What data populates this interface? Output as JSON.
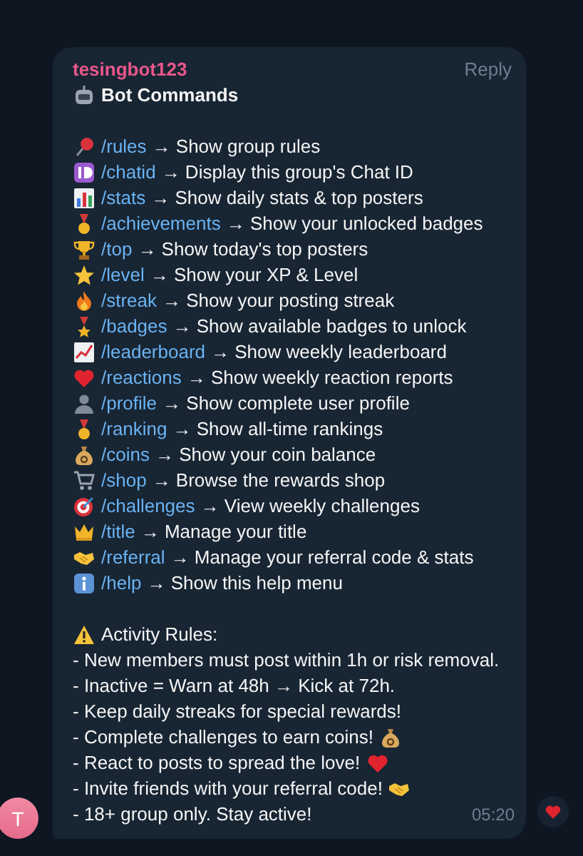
{
  "message": {
    "sender": "tesingbot123",
    "reply_label": "Reply",
    "title": "Bot Commands",
    "commands": [
      {
        "command": "/rules",
        "description": "→ Show group rules"
      },
      {
        "command": "/chatid",
        "description": "→ Display this group's Chat ID"
      },
      {
        "command": "/stats",
        "description": "→ Show daily stats & top posters"
      },
      {
        "command": "/achievements",
        "description": "→ Show your unlocked badges"
      },
      {
        "command": "/top",
        "description": "→ Show today's top posters"
      },
      {
        "command": "/level",
        "description": "→ Show your XP & Level"
      },
      {
        "command": "/streak",
        "description": "→ Show your posting streak"
      },
      {
        "command": "/badges",
        "description": "→ Show available badges to unlock"
      },
      {
        "command": "/leaderboard",
        "description": "→ Show weekly leaderboard"
      },
      {
        "command": "/reactions",
        "description": "→ Show weekly reaction reports"
      },
      {
        "command": "/profile",
        "description": "→ Show complete user profile"
      },
      {
        "command": "/ranking",
        "description": "→ Show all-time rankings"
      },
      {
        "command": "/coins",
        "description": "→ Show your coin balance"
      },
      {
        "command": "/shop",
        "description": "→ Browse the rewards shop"
      },
      {
        "command": "/challenges",
        "description": "→ View weekly challenges"
      },
      {
        "command": "/title",
        "description": "→ Manage your title"
      },
      {
        "command": "/referral",
        "description": "→ Manage your referral code & stats"
      },
      {
        "command": "/help",
        "description": "→ Show this help menu"
      }
    ],
    "rules_title": "Activity Rules:",
    "rules": [
      "- New members must post within 1h or risk removal.",
      "- Inactive = Warn at 48h → Kick at 72h.",
      "- Keep daily streaks for special rewards!",
      "- Complete challenges to earn coins!",
      "- React to posts to spread the love!",
      "- Invite friends with your referral code!",
      "- 18+ group only. Stay active!"
    ],
    "time": "05:20"
  },
  "avatar": {
    "initial": "T"
  }
}
